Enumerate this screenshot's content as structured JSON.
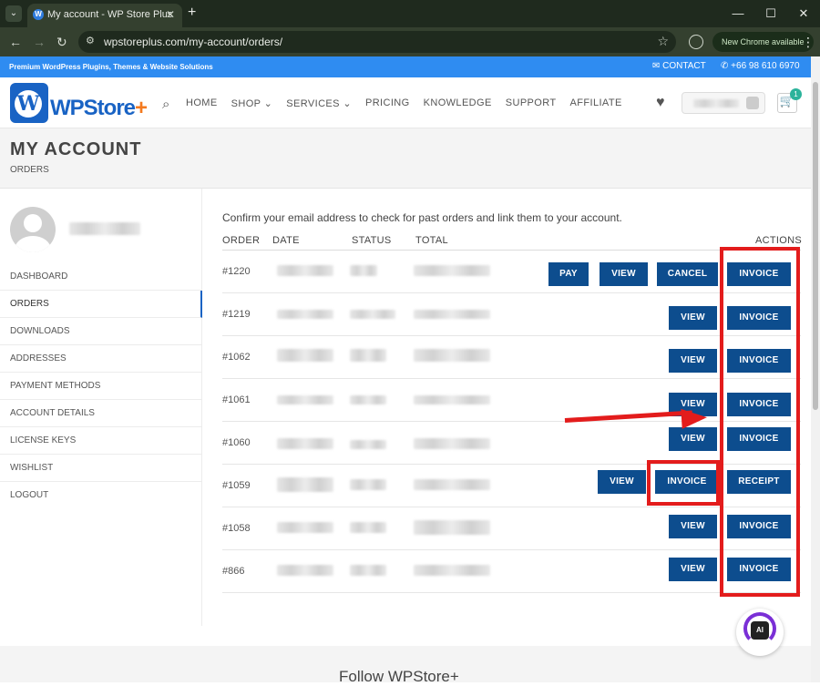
{
  "browser": {
    "tab_title": "My account - WP Store Plus",
    "url": "wpstoreplus.com/my-account/orders/",
    "new_chrome": "New Chrome available"
  },
  "topbar": {
    "tagline": "Premium WordPress Plugins, Themes & Website Solutions",
    "contact": "CONTACT",
    "phone": "+66 98 610 6970"
  },
  "header": {
    "logo_main": "WPStore",
    "logo_plus": "+",
    "menu": [
      "HOME",
      "SHOP ⌄",
      "SERVICES ⌄",
      "PRICING",
      "KNOWLEDGE",
      "SUPPORT",
      "AFFILIATE"
    ],
    "cart_count": "1"
  },
  "page": {
    "title": "MY ACCOUNT",
    "breadcrumb": "ORDERS"
  },
  "sidebar": {
    "items": [
      "DASHBOARD",
      "ORDERS",
      "DOWNLOADS",
      "ADDRESSES",
      "PAYMENT METHODS",
      "ACCOUNT DETAILS",
      "LICENSE KEYS",
      "WISHLIST",
      "LOGOUT"
    ]
  },
  "orders": {
    "notice": "Confirm your email address to check for past orders and link them to your account.",
    "headers": {
      "order": "ORDER",
      "date": "DATE",
      "status": "STATUS",
      "total": "TOTAL",
      "actions": "ACTIONS"
    },
    "rows": [
      {
        "number": "#1220",
        "actions": [
          "PAY",
          "VIEW",
          "CANCEL",
          "INVOICE"
        ]
      },
      {
        "number": "#1219",
        "actions": [
          "VIEW",
          "INVOICE"
        ]
      },
      {
        "number": "#1062",
        "actions": [
          "VIEW",
          "INVOICE"
        ]
      },
      {
        "number": "#1061",
        "actions": [
          "VIEW",
          "INVOICE"
        ]
      },
      {
        "number": "#1060",
        "actions": [
          "VIEW",
          "INVOICE"
        ]
      },
      {
        "number": "#1059",
        "actions": [
          "VIEW",
          "INVOICE",
          "RECEIPT"
        ]
      },
      {
        "number": "#1058",
        "actions": [
          "VIEW",
          "INVOICE"
        ]
      },
      {
        "number": "#866",
        "actions": [
          "VIEW",
          "INVOICE"
        ]
      }
    ]
  },
  "footer": {
    "follow": "Follow WPStore+"
  },
  "ai_badge": "AI",
  "colors": {
    "button": "#0d4d8e",
    "annotation": "#e31c1c",
    "topbar": "#2f8cf1",
    "brand": "#1963c4",
    "brand_accent": "#f47a1f"
  }
}
